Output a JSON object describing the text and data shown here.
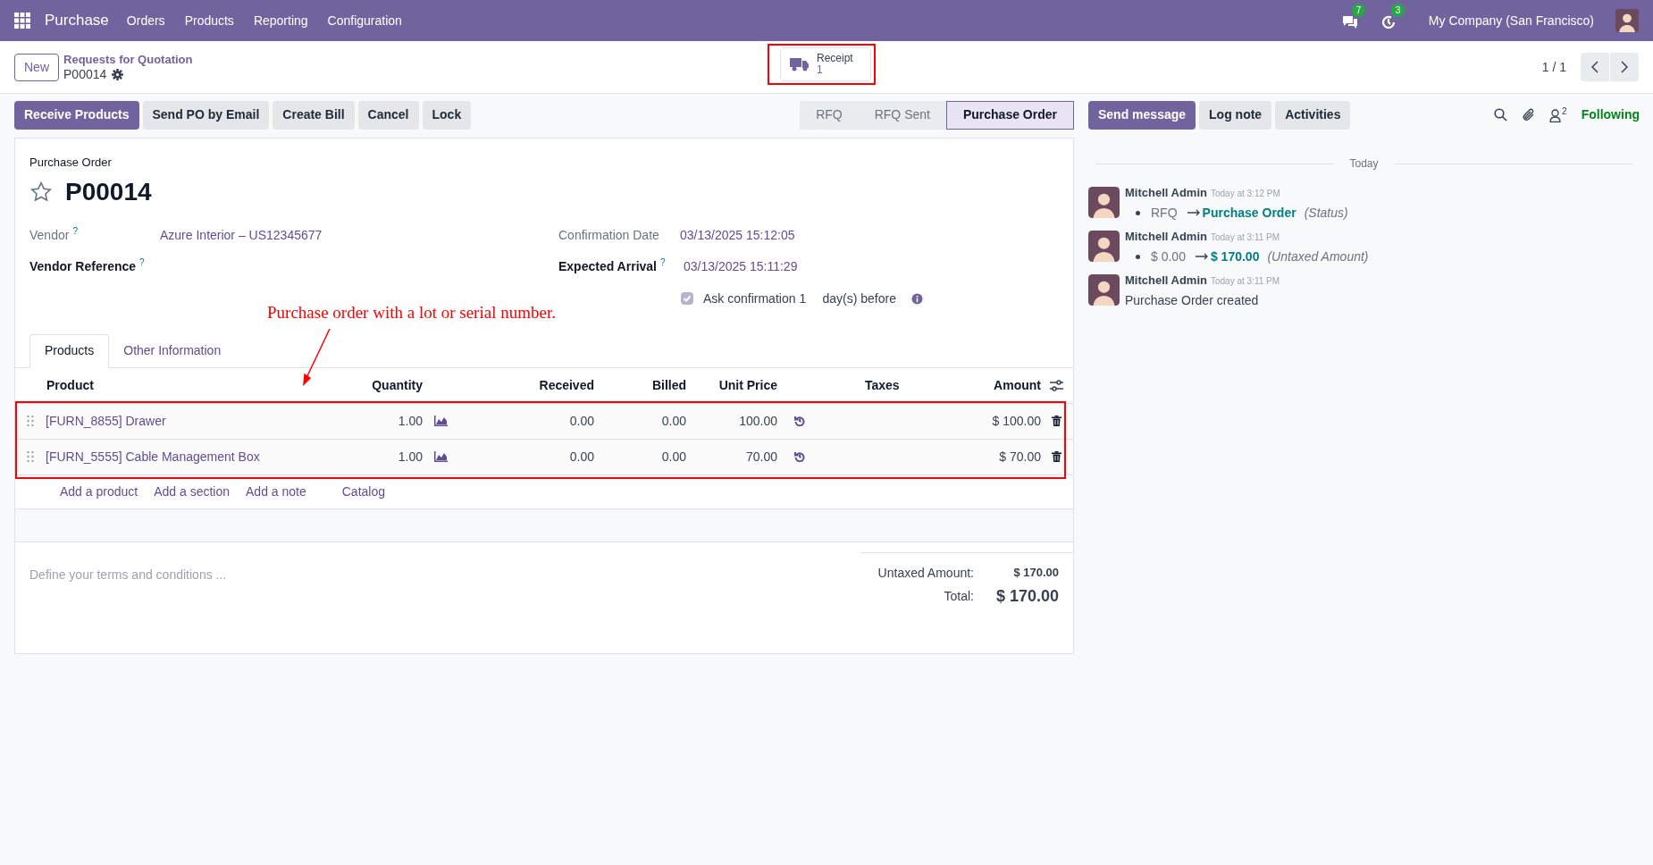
{
  "navbar": {
    "app_name": "Purchase",
    "menu": [
      "Orders",
      "Products",
      "Reporting",
      "Configuration"
    ],
    "chat_badge": "7",
    "activity_badge": "3",
    "company": "My Company (San Francisco)"
  },
  "control_panel": {
    "new_button": "New",
    "breadcrumb": "Requests for Quotation",
    "record": "P00014",
    "smart_button": {
      "label": "Receipt",
      "count": "1"
    },
    "pager": "1 / 1"
  },
  "actions": [
    {
      "label": "Receive Products",
      "kind": "primary"
    },
    {
      "label": "Send PO by Email",
      "kind": "secondary"
    },
    {
      "label": "Create Bill",
      "kind": "secondary"
    },
    {
      "label": "Cancel",
      "kind": "secondary"
    },
    {
      "label": "Lock",
      "kind": "secondary"
    }
  ],
  "stages": [
    {
      "label": "RFQ",
      "selected": false
    },
    {
      "label": "RFQ Sent",
      "selected": false
    },
    {
      "label": "Purchase Order",
      "selected": true
    }
  ],
  "chatter_buttons": [
    {
      "label": "Send message",
      "kind": "primary"
    },
    {
      "label": "Log note",
      "kind": "secondary"
    },
    {
      "label": "Activities",
      "kind": "secondary"
    }
  ],
  "followers_count": "2",
  "following": "Following",
  "form": {
    "title_label": "Purchase Order",
    "name": "P00014",
    "starred": false,
    "left_fields": [
      {
        "label": "Vendor",
        "bold": false,
        "help": "?",
        "value": "Azure Interior – US12345677"
      },
      {
        "label": "Vendor Reference",
        "bold": true,
        "help": "?"
      }
    ],
    "right_fields": [
      {
        "label": "Confirmation Date",
        "bold": false,
        "value": "03/13/2025 15:12:05"
      },
      {
        "label": "Expected Arrival",
        "bold": true,
        "help": "?",
        "value": "03/13/2025 15:11:29"
      }
    ],
    "ask_confirmation": {
      "checked": true,
      "label": "Ask confirmation",
      "value": "1",
      "suffix": "day(s) before"
    }
  },
  "annotation": "Purchase order with a lot or serial number.",
  "tabs": [
    {
      "label": "Products",
      "selected": true
    },
    {
      "label": "Other Information",
      "selected": false
    }
  ],
  "table": {
    "columns": [
      "Product",
      "Quantity",
      "Received",
      "Billed",
      "Unit Price",
      "Taxes",
      "Amount"
    ],
    "rows": [
      {
        "product": "[FURN_8855] Drawer",
        "quantity": "1.00",
        "received": "0.00",
        "billed": "0.00",
        "unit_price": "100.00",
        "amount": "$ 100.00"
      },
      {
        "product": "[FURN_5555] Cable Management Box",
        "quantity": "1.00",
        "received": "0.00",
        "billed": "0.00",
        "unit_price": "70.00",
        "amount": "$ 70.00"
      }
    ],
    "add_links": [
      "Add a product",
      "Add a section",
      "Add a note",
      "Catalog"
    ]
  },
  "terms_placeholder": "Define your terms and conditions ...",
  "totals": [
    {
      "label": "Untaxed Amount:",
      "value": "$ 170.00",
      "kind": "subtotal"
    },
    {
      "label": "Total:",
      "value": "$ 170.00",
      "kind": "total"
    }
  ],
  "chatter": {
    "date": "Today",
    "messages": [
      {
        "kind": "tracking",
        "author": "Mitchell Admin",
        "time": "Today at 3:12 PM",
        "old": "RFQ",
        "new": "Purchase Order",
        "field": "(Status)"
      },
      {
        "kind": "tracking",
        "author": "Mitchell Admin",
        "time": "Today at 3:11 PM",
        "old": "$ 0.00",
        "new": "$ 170.00",
        "field": "(Untaxed Amount)"
      },
      {
        "kind": "text",
        "author": "Mitchell Admin",
        "time": "Today at 3:11 PM",
        "body": "Purchase Order created"
      }
    ]
  }
}
